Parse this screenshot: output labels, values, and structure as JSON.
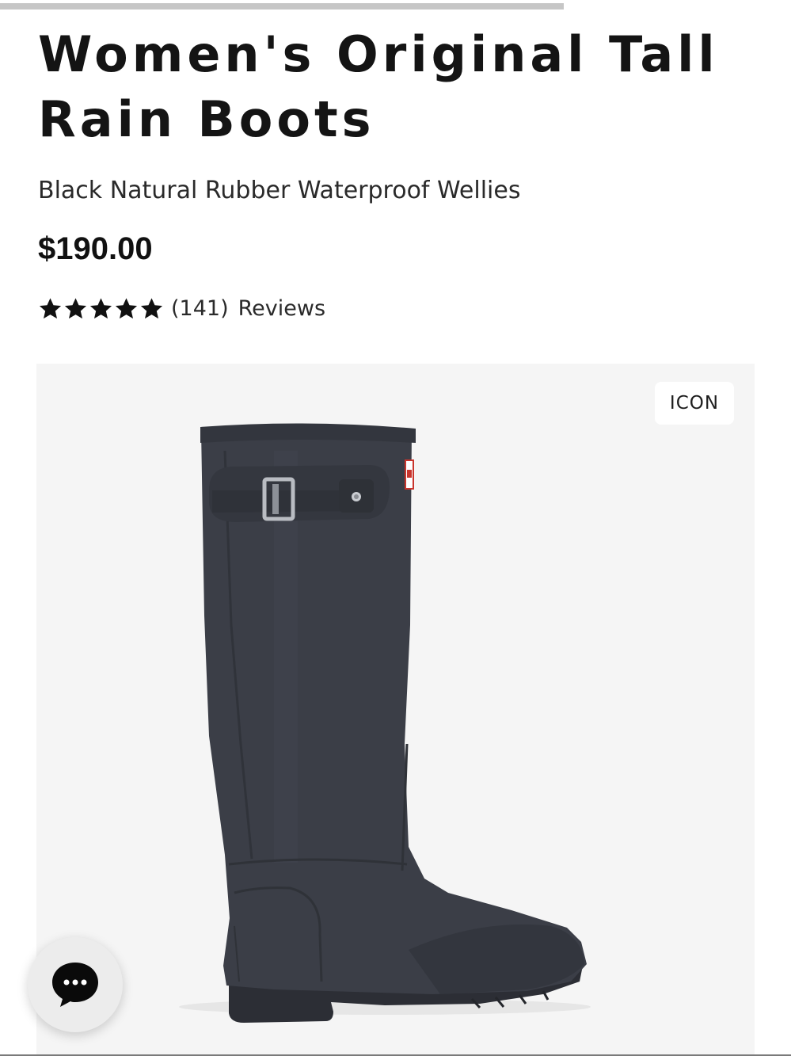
{
  "product": {
    "title": "Women's Original Tall Rain Boots",
    "subtitle": "Black Natural Rubber Waterproof Wellies",
    "price": "$190.00",
    "rating": {
      "stars": 5,
      "max_stars": 5,
      "count": "(141)",
      "reviews_label": "Reviews"
    },
    "badge": "ICON",
    "image_icon": "rain-boot-image"
  },
  "chat": {
    "icon": "chat-bubble-icon"
  },
  "colors": {
    "text": "#111111",
    "image_background": "#f5f5f5",
    "boot": "#3b3e47",
    "progress": "#c6c6c6"
  }
}
